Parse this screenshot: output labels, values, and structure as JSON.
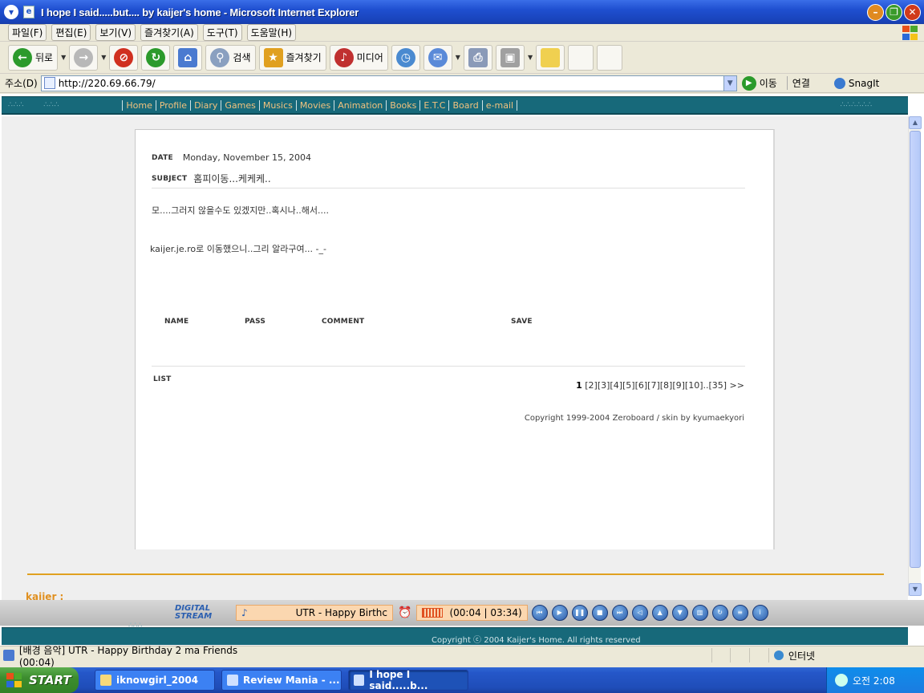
{
  "window": {
    "title": "I hope I said.....but.... by kaijer's home - Microsoft Internet Explorer"
  },
  "menu": [
    "파일(F)",
    "편집(E)",
    "보기(V)",
    "즐겨찾기(A)",
    "도구(T)",
    "도움말(H)"
  ],
  "toolbar": {
    "back": "뒤로",
    "search": "검색",
    "favorites": "즐겨찾기",
    "media": "미디어"
  },
  "address": {
    "label": "주소(D)",
    "url": "http://220.69.66.79/",
    "go": "이동",
    "links": "연결",
    "snagit": "SnagIt"
  },
  "site_nav": [
    "Home",
    "Profile",
    "Diary",
    "Games",
    "Musics",
    "Movies",
    "Animation",
    "Books",
    "E.T.C",
    "Board",
    "e-mail"
  ],
  "post": {
    "date_label": "DATE",
    "date": "Monday, November 15, 2004",
    "subject_label": "SUBJECT",
    "subject": "홈피이동...케케케..",
    "body_line1": "모....그러지 않을수도 있겠지만..혹시나..해서....",
    "body_line2": "kaijer.je.ro로 이동했으니..그리 알라구여... -_-"
  },
  "comment_form": {
    "name": "NAME",
    "pass": "PASS",
    "comment": "COMMENT",
    "save": "SAVE"
  },
  "list": {
    "label": "LIST",
    "current_page": "1",
    "pages": "[2][3][4][5][6][7][8][9][10]..[35] >>"
  },
  "board_copyright": "Copyright 1999-2004 Zeroboard / skin by kyumaekyori",
  "author": "kaijer :",
  "player": {
    "logo_line1": "DIGITAL",
    "logo_line2": "STREAM",
    "track": "UTR - Happy Birthc",
    "time": "(00:04 | 03:34)"
  },
  "site_footer": "Copyright ⓒ 2004 Kaijer's Home. All rights reserved",
  "status": {
    "text": "[배경 음악] UTR - Happy Birthday 2 ma Friends (00:04)",
    "zone": "인터넷"
  },
  "taskbar": {
    "start": "START",
    "tasks": [
      "iknowgirl_2004",
      "Review Mania - ...",
      "I hope I said.....b..."
    ],
    "clock": "오전 2:08"
  }
}
